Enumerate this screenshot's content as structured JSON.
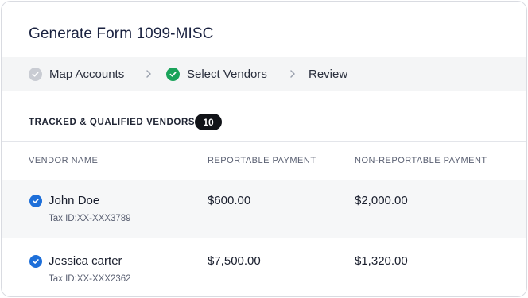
{
  "title": "Generate Form 1099-MISC",
  "steps": [
    {
      "label": "Map Accounts",
      "state": "done-muted"
    },
    {
      "label": "Select Vendors",
      "state": "done"
    },
    {
      "label": "Review",
      "state": "pending"
    }
  ],
  "section": {
    "label": "TRACKED & QUALIFIED VENDORS",
    "count": "10"
  },
  "columns": {
    "vendor": "VENDOR NAME",
    "reportable": "REPORTABLE PAYMENT",
    "non_reportable": "NON-REPORTABLE PAYMENT"
  },
  "vendors": [
    {
      "name": "John Doe",
      "tax_id": "Tax ID:XX-XXX3789",
      "reportable": "$600.00",
      "non_reportable": "$2,000.00",
      "checked": true
    },
    {
      "name": "Jessica carter",
      "tax_id": "Tax ID:XX-XXX2362",
      "reportable": "$7,500.00",
      "non_reportable": "$1,320.00",
      "checked": true
    }
  ],
  "colors": {
    "accent": "#1e6fd9",
    "success": "#1aa35a",
    "muted": "#c9ccd3"
  }
}
